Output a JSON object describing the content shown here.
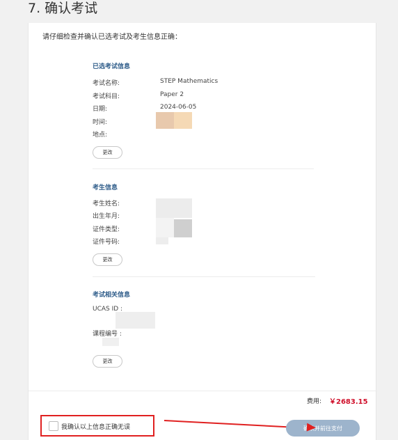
{
  "step_title": "7. 确认考试",
  "intro": "请仔细检查并确认已选考试及考生信息正确：",
  "exam_section": {
    "title": "已选考试信息",
    "rows": [
      {
        "label": "考试名称:",
        "value": "STEP Mathematics"
      },
      {
        "label": "考试科目:",
        "value": "Paper 2"
      },
      {
        "label": "日期:",
        "value": "2024-06-05"
      },
      {
        "label": "时间:",
        "value": ""
      },
      {
        "label": "地点:",
        "value": ""
      }
    ],
    "edit_label": "更改"
  },
  "candidate_section": {
    "title": "考生信息",
    "rows": [
      {
        "label": "考生姓名:"
      },
      {
        "label": "出生年月:"
      },
      {
        "label": "证件类型:"
      },
      {
        "label": "证件号码:"
      }
    ],
    "edit_label": "更改"
  },
  "related_section": {
    "title": "考试相关信息",
    "rows": [
      {
        "label": "UCAS ID :"
      },
      {
        "label": "课程编号 :"
      }
    ],
    "edit_label": "更改"
  },
  "fee": {
    "label": "费用:",
    "value": "￥2683.15"
  },
  "confirm_checkbox_label": "我确认以上信息正确无误",
  "submit_label": "确认并前往支付",
  "colors": {
    "section_title": "#2f5d8a",
    "fee": "#d0102b",
    "annotation_red": "#e02020",
    "submit_button": "#9db4cc"
  }
}
